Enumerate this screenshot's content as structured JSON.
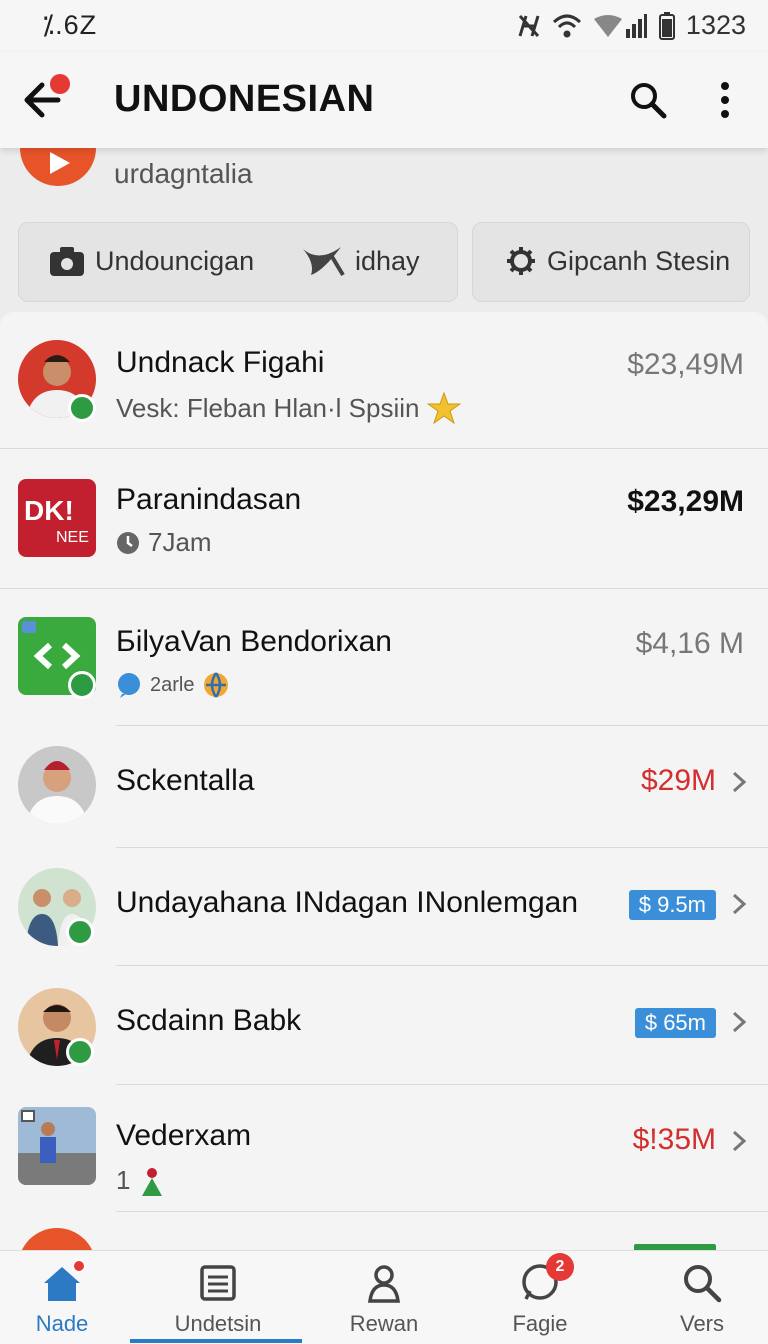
{
  "status_bar": {
    "left_text": "⁒.6Z",
    "time": "1323"
  },
  "app_bar": {
    "title": "UNDONESIAN"
  },
  "channel": {
    "name": "urdagntalia"
  },
  "actions": {
    "left_a": "Undouncigan",
    "left_b": "idhay",
    "right": "Gipcanh Stesin"
  },
  "items": [
    {
      "title": "Undnack Figahi",
      "subtitle": "Vesk: Fleban Hlan·l Spsiin",
      "amount": "$23,49M"
    },
    {
      "title": "Paranindasan",
      "subtitle": "7Jam",
      "amount": "$23,29M",
      "logo_main": "DK!",
      "logo_sub": "NEE"
    },
    {
      "title": "БilyaVan Bendorixan",
      "subtitle": "2arle",
      "amount": "$4,16 M"
    },
    {
      "title": "Sckentalla",
      "amount": "$29M"
    },
    {
      "title": "Undayahana INdagan INonlemgan",
      "amount": "$ 9.5m"
    },
    {
      "title": "Scdainn Babk",
      "amount": "$ 65m"
    },
    {
      "title": "Vederxam",
      "subtitle": "1",
      "amount": "$!35M"
    }
  ],
  "bottom_nav": [
    {
      "label": "Nade"
    },
    {
      "label": "Undetsin"
    },
    {
      "label": "Rewan"
    },
    {
      "label": "Fagie",
      "badge": "2"
    },
    {
      "label": "Vers"
    }
  ],
  "colors": {
    "accent_blue": "#2c7ac4",
    "red": "#d32f2f",
    "green_badge": "#2e9b43",
    "channel_orange": "#e8542a"
  }
}
